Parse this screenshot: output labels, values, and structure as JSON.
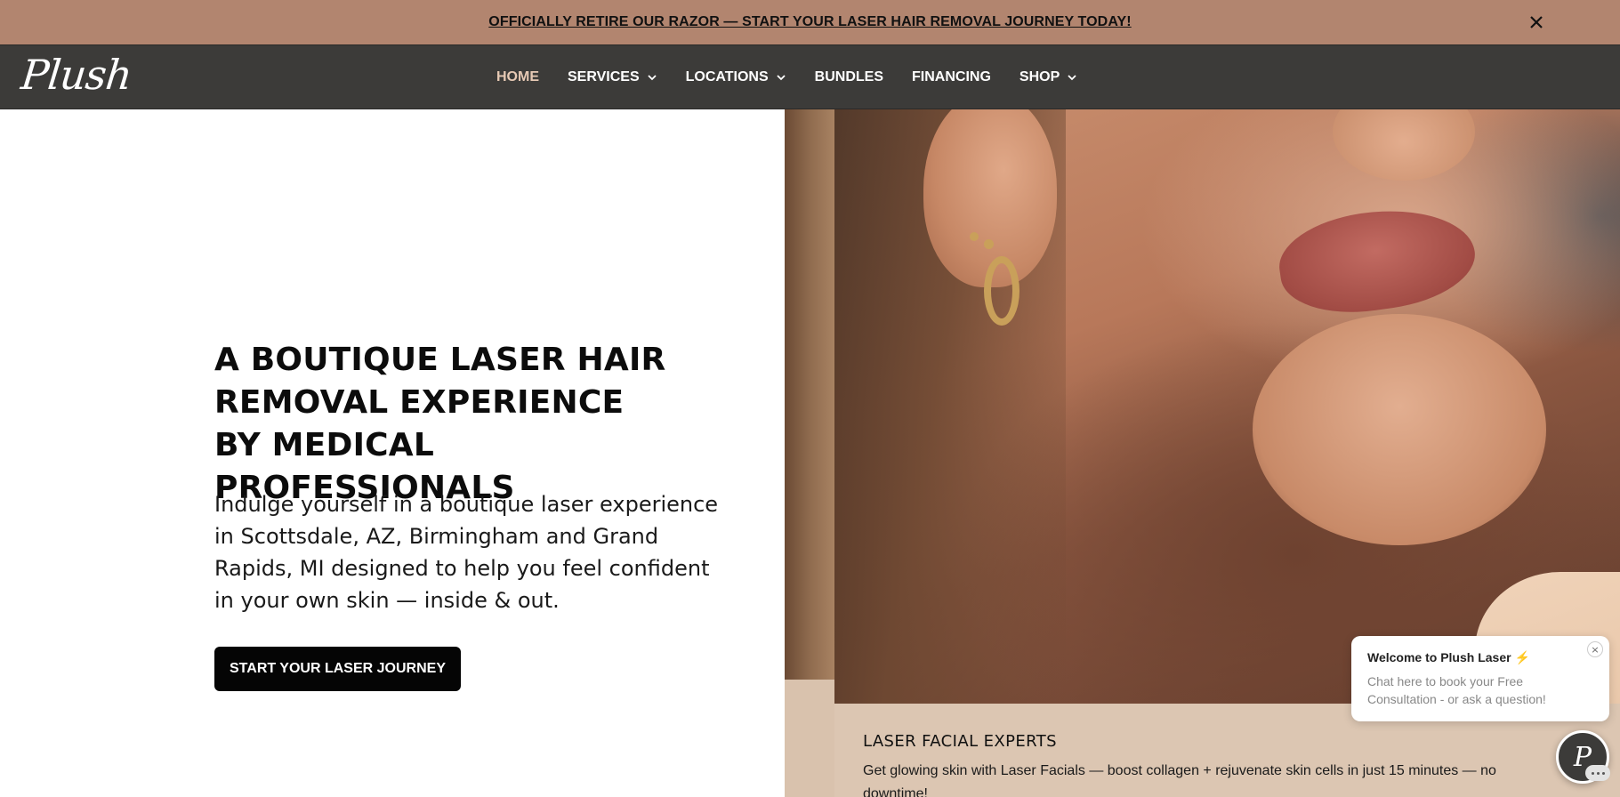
{
  "announcement": {
    "text": "OFFICIALLY RETIRE OUR RAZOR — START YOUR LASER HAIR REMOVAL JOURNEY TODAY!"
  },
  "nav": {
    "logo": "Plush",
    "items": [
      {
        "label": "HOME",
        "active": true,
        "dropdown": false
      },
      {
        "label": "SERVICES",
        "active": false,
        "dropdown": true
      },
      {
        "label": "LOCATIONS",
        "active": false,
        "dropdown": true
      },
      {
        "label": "BUNDLES",
        "active": false,
        "dropdown": false
      },
      {
        "label": "FINANCING",
        "active": false,
        "dropdown": false
      },
      {
        "label": "SHOP",
        "active": false,
        "dropdown": true
      }
    ]
  },
  "hero": {
    "title": "A BOUTIQUE LASER HAIR REMOVAL EXPERIENCE BY MEDICAL PROFESSIONALS",
    "subtitle": "Indulge yourself in a boutique laser experience in Scottsdale, AZ, Birmingham and Grand Rapids, MI designed to help you feel confident in your own skin — inside & out.",
    "cta": "START YOUR LASER JOURNEY"
  },
  "feature_card": {
    "title": "LASER FACIAL EXPERTS",
    "description": "Get glowing skin with Laser Facials — boost collagen + rejuvenate skin cells in just 15 minutes — no downtime!"
  },
  "chat": {
    "title": "Welcome to Plush Laser",
    "message": "Chat here to book your Free Consultation - or ask a question!",
    "close": "×",
    "launcher_letter": "P"
  },
  "colors": {
    "announcement_bg": "#b2856f",
    "nav_bg": "#3c3b39",
    "nav_active": "#e6c9b4",
    "cta_bg": "#050505",
    "card_bg": "#dcc6b2"
  }
}
